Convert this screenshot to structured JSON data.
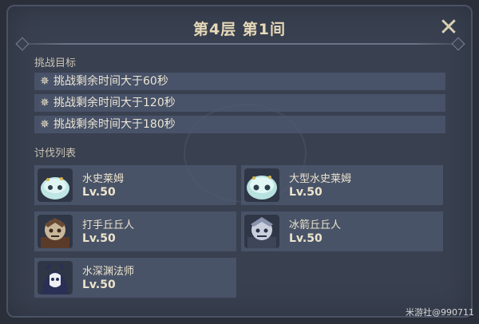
{
  "header": {
    "title": "第4层 第1间",
    "close_icon": "close-icon"
  },
  "objectives": {
    "label": "挑战目标",
    "icon": "star-icon",
    "items": [
      "挑战剩余时间大于60秒",
      "挑战剩余时间大于120秒",
      "挑战剩余时间大于180秒"
    ]
  },
  "enemies": {
    "label": "讨伐列表",
    "items": [
      {
        "name": "水史莱姆",
        "level": "Lv.50",
        "icon": "hydro-slime-portrait"
      },
      {
        "name": "大型水史莱姆",
        "level": "Lv.50",
        "icon": "large-hydro-slime-portrait"
      },
      {
        "name": "打手丘丘人",
        "level": "Lv.50",
        "icon": "hilichurl-fighter-portrait"
      },
      {
        "name": "冰箭丘丘人",
        "level": "Lv.50",
        "icon": "cryo-hilichurl-shooter-portrait"
      },
      {
        "name": "水深渊法师",
        "level": "Lv.50",
        "icon": "hydro-abyss-mage-portrait"
      }
    ]
  },
  "watermark": "米游社@990711",
  "colors": {
    "panel": "#394050",
    "row": "#4e5870",
    "text": "#ece4cc",
    "title": "#e6d9b8"
  }
}
